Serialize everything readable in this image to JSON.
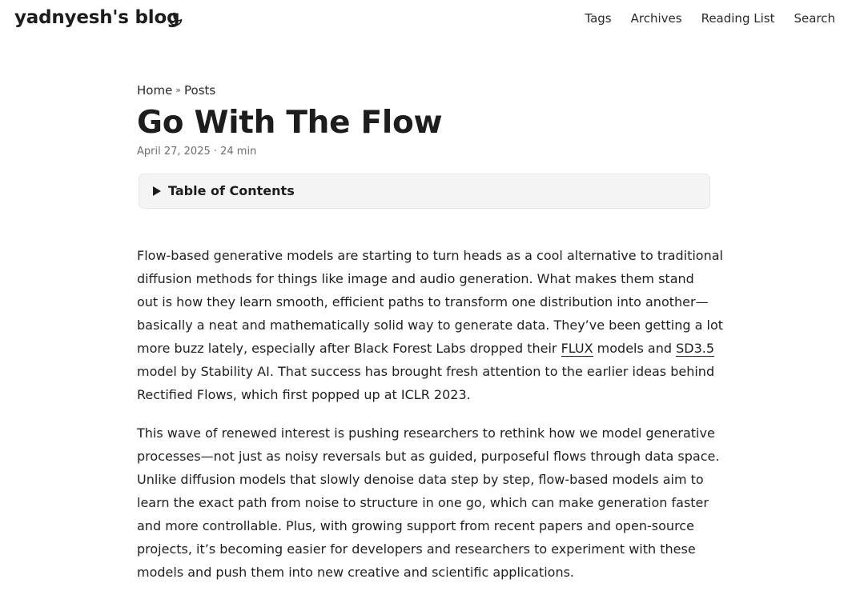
{
  "header": {
    "logo": "yadnyesh's blog",
    "theme_toggle_icon": "moon-icon",
    "nav": [
      "Tags",
      "Archives",
      "Reading List",
      "Search"
    ]
  },
  "breadcrumb": {
    "home": "Home",
    "separator": "»",
    "posts": "Posts"
  },
  "post": {
    "title": "Go With The Flow",
    "meta": "April 27, 2025 · 24 min",
    "toc_label": "Table of Contents",
    "p1": {
      "l1": "Flow-based generative models are starting to turn heads as a cool alternative to traditional",
      "l2": "diffusion methods for things like image and audio generation. What makes them stand",
      "l3": "out is how they learn smooth, efficient paths to transform one distribution into another—",
      "l4": "basically a neat and mathematically solid way to generate data. They’ve been getting a lot",
      "l5_pre": "more buzz lately, especially after Black Forest Labs dropped their ",
      "link_flux": "FLUX",
      "l5_mid": " models and ",
      "link_sd": "SD3.5",
      "l6": "model by Stability AI. That success has brought fresh attention to the earlier ideas behind",
      "l7": "Rectified Flows, which first popped up at ICLR 2023."
    },
    "p2": {
      "l1": "This wave of renewed interest is pushing researchers to rethink how we model generative",
      "l2": "processes—not just as noisy reversals but as guided, purposeful flows through data space.",
      "l3": "Unlike diffusion models that slowly denoise data step by step, flow-based models aim to",
      "l4": "learn the exact path from noise to structure in one go, which can make generation faster",
      "l5": "and more controllable. Plus, with growing support from recent papers and open-source",
      "l6": "projects, it’s becoming easier for developers and researchers to experiment with these",
      "l7": "models and push them into new creative and scientific applications."
    }
  }
}
